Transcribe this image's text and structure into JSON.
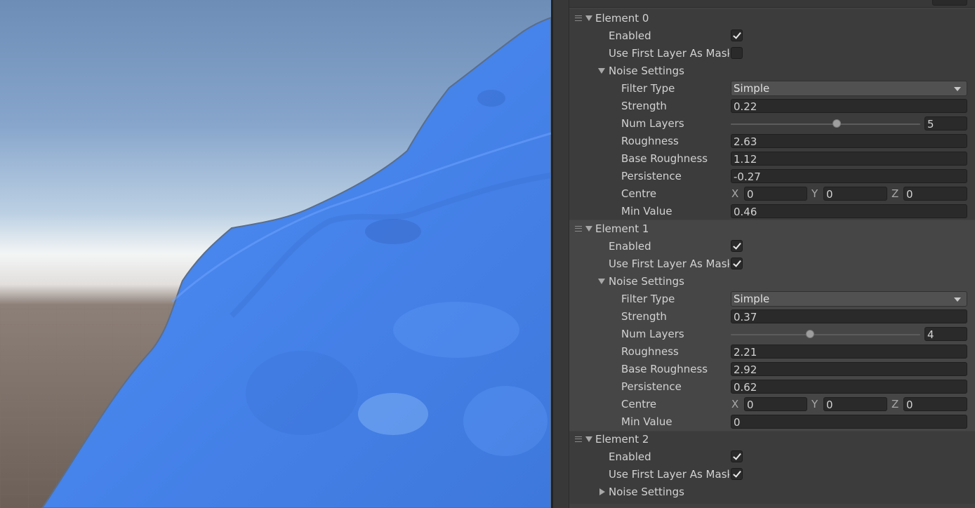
{
  "inspector": {
    "elements": [
      {
        "label": "Element 0",
        "enabled_label": "Enabled",
        "enabled": true,
        "mask_label": "Use First Layer As Mask",
        "mask": false,
        "noise_label": "Noise Settings",
        "noise_expanded": true,
        "filter_type_label": "Filter Type",
        "filter_type": "Simple",
        "strength_label": "Strength",
        "strength": "0.22",
        "num_layers_label": "Num Layers",
        "num_layers": "5",
        "num_layers_fraction": 0.56,
        "roughness_label": "Roughness",
        "roughness": "2.63",
        "base_roughness_label": "Base Roughness",
        "base_roughness": "1.12",
        "persistence_label": "Persistence",
        "persistence": "-0.27",
        "centre_label": "Centre",
        "centre_x": "0",
        "centre_y": "0",
        "centre_z": "0",
        "min_value_label": "Min Value",
        "min_value": "0.46"
      },
      {
        "label": "Element 1",
        "enabled_label": "Enabled",
        "enabled": true,
        "mask_label": "Use First Layer As Mask",
        "mask": true,
        "noise_label": "Noise Settings",
        "noise_expanded": true,
        "filter_type_label": "Filter Type",
        "filter_type": "Simple",
        "strength_label": "Strength",
        "strength": "0.37",
        "num_layers_label": "Num Layers",
        "num_layers": "4",
        "num_layers_fraction": 0.42,
        "roughness_label": "Roughness",
        "roughness": "2.21",
        "base_roughness_label": "Base Roughness",
        "base_roughness": "2.92",
        "persistence_label": "Persistence",
        "persistence": "0.62",
        "centre_label": "Centre",
        "centre_x": "0",
        "centre_y": "0",
        "centre_z": "0",
        "min_value_label": "Min Value",
        "min_value": "0"
      },
      {
        "label": "Element 2",
        "enabled_label": "Enabled",
        "enabled": true,
        "mask_label": "Use First Layer As Mask",
        "mask": true,
        "noise_label": "Noise Settings",
        "noise_expanded": false
      }
    ],
    "xyz": {
      "x": "X",
      "y": "Y",
      "z": "Z"
    }
  },
  "colors": {
    "planet": "#4a88f0",
    "sky_top": "#6f8fb8",
    "horizon": "#f2f4f4",
    "ground": "#6e625a",
    "inspector_bg": "#383838",
    "field_bg": "#2a2a2a"
  }
}
